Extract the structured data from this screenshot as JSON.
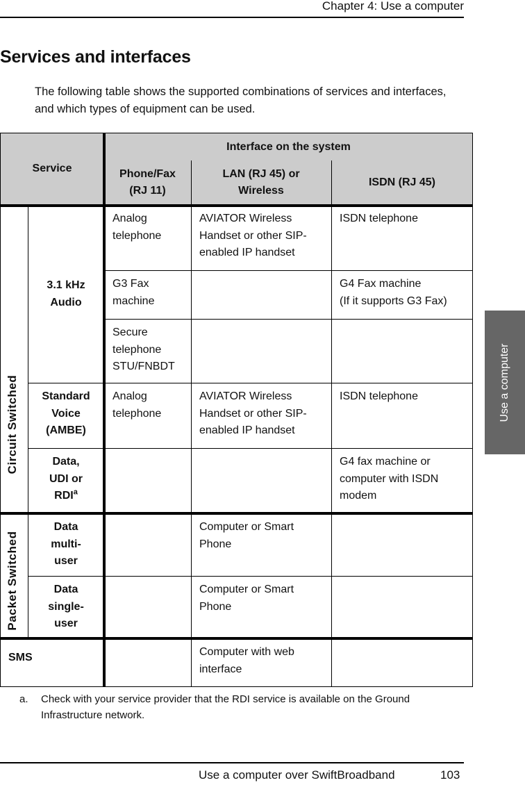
{
  "running_header": {
    "chapter": "Chapter 4:  Use a computer"
  },
  "section": {
    "title": "Services and interfaces",
    "intro": "The following table shows the supported combinations of services and interfaces, and which types of equipment can be used."
  },
  "table": {
    "headers": {
      "service": "Service",
      "interface_group": "Interface on the system",
      "columns": [
        "Phone/Fax (RJ 11)",
        "LAN (RJ 45) or Wireless",
        "ISDN (RJ 45)"
      ]
    },
    "groups": {
      "circuit": "Circuit Switched",
      "packet": "Packet Switched"
    },
    "services": {
      "audio": "3.1 kHz Audio",
      "voice": "Standard Voice (AMBE)",
      "data_udi_rdi": "Data, UDI or RDI",
      "data_udi_rdi_footnote_mark": "a",
      "data_multi": "Data multi-user",
      "data_single": "Data single-user",
      "sms": "SMS"
    },
    "rows": [
      {
        "service": "3.1 kHz Audio",
        "phone": "Analog telephone",
        "lan": "AVIATOR Wireless Handset or other SIP-enabled IP handset",
        "isdn": "ISDN telephone"
      },
      {
        "service": "3.1 kHz Audio",
        "phone": "G3 Fax machine",
        "lan": "",
        "isdn": "G4 Fax machine\n(If it supports G3 Fax)"
      },
      {
        "service": "3.1 kHz Audio",
        "phone": "Secure telephone STU/FNBDT",
        "lan": "",
        "isdn": ""
      },
      {
        "service": "Standard Voice (AMBE)",
        "phone": "Analog telephone",
        "lan": "AVIATOR Wireless Handset or other SIP-enabled IP handset",
        "isdn": "ISDN telephone"
      },
      {
        "service": "Data, UDI or RDI",
        "phone": "",
        "lan": "",
        "isdn": "G4 fax machine or computer with ISDN modem"
      },
      {
        "service": "Data multi-user",
        "phone": "",
        "lan": "Computer or Smart Phone",
        "isdn": ""
      },
      {
        "service": "Data single-user",
        "phone": "",
        "lan": "Computer or Smart Phone",
        "isdn": ""
      },
      {
        "service": "SMS",
        "phone": "",
        "lan": "Computer with web interface",
        "isdn": ""
      }
    ]
  },
  "footnote": {
    "mark": "a.",
    "text": "Check with your service provider that the RDI service is available on the Ground Infrastructure network."
  },
  "side_tab": {
    "label": "Use a computer"
  },
  "running_footer": {
    "title": "Use a computer over SwiftBroadband",
    "page": "103"
  }
}
